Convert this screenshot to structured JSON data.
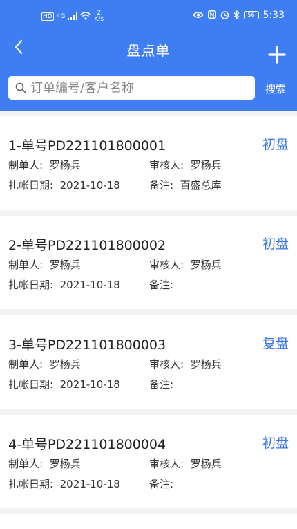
{
  "status_bar": {
    "network": "HD",
    "signal": "4G",
    "speed_value": "2",
    "speed_unit": "K/s",
    "battery": "56",
    "time": "5:33"
  },
  "nav": {
    "title": "盘点单"
  },
  "search": {
    "placeholder": "订单编号/客户名称",
    "value": "",
    "button_label": "搜索"
  },
  "labels": {
    "maker": "制单人:",
    "reviewer": "审核人:",
    "date": "扎帐日期:",
    "remark": "备注:"
  },
  "orders": [
    {
      "title": "1-单号PD221101800001",
      "type": "初盘",
      "maker": "罗杨兵",
      "reviewer": "罗杨兵",
      "date": "2021-10-18",
      "remark": "百盛总库"
    },
    {
      "title": "2-单号PD221101800002",
      "type": "初盘",
      "maker": "罗杨兵",
      "reviewer": "罗杨兵",
      "date": "2021-10-18",
      "remark": ""
    },
    {
      "title": "3-单号PD221101800003",
      "type": "复盘",
      "maker": "罗杨兵",
      "reviewer": "罗杨兵",
      "date": "2021-10-18",
      "remark": ""
    },
    {
      "title": "4-单号PD221101800004",
      "type": "初盘",
      "maker": "罗杨兵",
      "reviewer": "罗杨兵",
      "date": "2021-10-18",
      "remark": ""
    }
  ],
  "colors": {
    "header": "#3f7ef2",
    "type_text": "#3a78e6",
    "background": "#f2f3f5"
  }
}
